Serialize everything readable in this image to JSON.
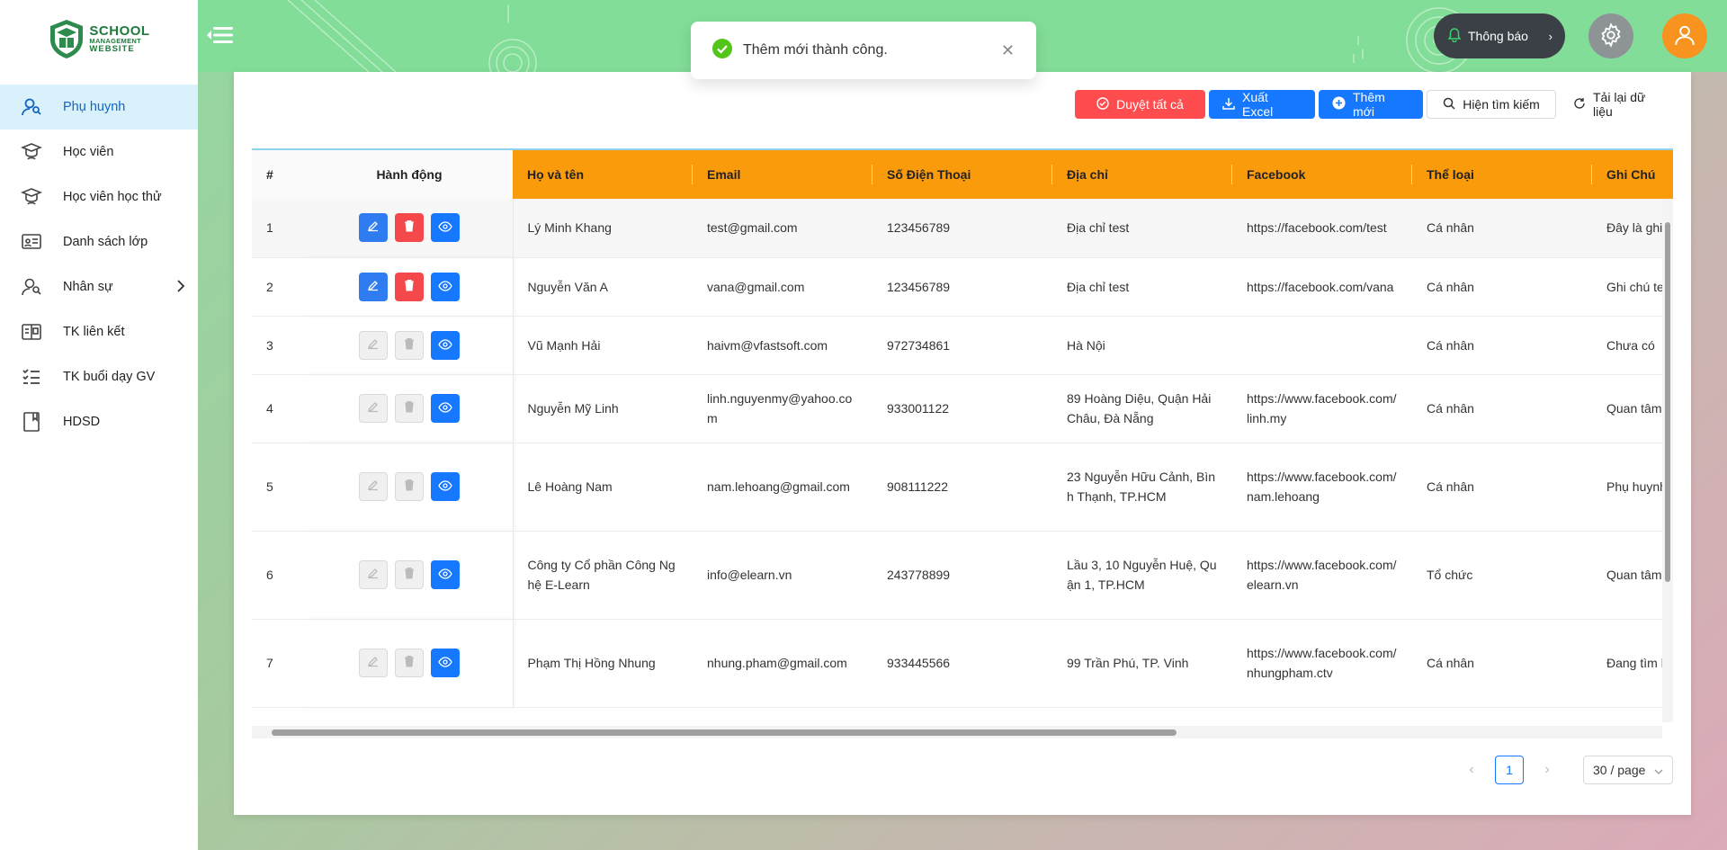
{
  "brand": {
    "line1": "SCHOOL",
    "line2": "MANAGEMENT",
    "line3": "WEBSITE"
  },
  "sidebar": {
    "items": [
      {
        "label": "Phụ huynh",
        "icon": "parent-icon",
        "active": true
      },
      {
        "label": "Học viên",
        "icon": "graduate-icon"
      },
      {
        "label": "Học viên học thử",
        "icon": "trial-student-icon"
      },
      {
        "label": "Danh sách lớp",
        "icon": "classroom-icon"
      },
      {
        "label": "Nhân sự",
        "icon": "staff-icon",
        "has_submenu": true
      },
      {
        "label": "TK liên kết",
        "icon": "linked-account-icon"
      },
      {
        "label": "TK buổi dạy GV",
        "icon": "checklist-icon"
      },
      {
        "label": "HDSD",
        "icon": "book-icon"
      }
    ]
  },
  "header": {
    "notify_label": "Thông báo"
  },
  "toast": {
    "message": "Thêm mới thành công."
  },
  "toolbar": {
    "approve_all": "Duyệt tất cả",
    "export_excel": "Xuất Excel",
    "add_new": "Thêm mới",
    "show_search": "Hiện tìm kiếm",
    "reload": "Tải lại dữ liệu"
  },
  "table": {
    "columns": [
      "#",
      "Hành động",
      "Họ và tên",
      "Email",
      "Số Điện Thoại",
      "Địa chỉ",
      "Facebook",
      "Thể loại",
      "Ghi Chú"
    ],
    "rows": [
      {
        "no": "1",
        "name": "Lý Minh Khang",
        "email": "test@gmail.com",
        "phone": "123456789",
        "address": "Địa chỉ test",
        "facebook": "https://facebook.com/test",
        "type": "Cá nhân",
        "note": "Đây là ghi chú test",
        "editable": true
      },
      {
        "no": "2",
        "name": "Nguyễn Văn A",
        "email": "vana@gmail.com",
        "phone": "123456789",
        "address": "Địa chỉ test",
        "facebook": "https://facebook.com/vana",
        "type": "Cá nhân",
        "note": "Ghi chú test",
        "editable": true
      },
      {
        "no": "3",
        "name": "Vũ Mạnh Hải",
        "email": "haivm@vfastsoft.com",
        "phone": "972734861",
        "address": "Hà Nội",
        "facebook": "",
        "type": "Cá nhân",
        "note": "Chưa có",
        "editable": false
      },
      {
        "no": "4",
        "name": "Nguyễn Mỹ Linh",
        "email": "linh.nguyenmy@yahoo.com",
        "phone": "933001122",
        "address": "89 Hoàng Diệu, Quận Hải Châu, Đà Nẵng",
        "facebook": "https://www.facebook.com/linh.my",
        "type": "Cá nhân",
        "note": "Quan tâm khoá tiếng giao tiếp cho người",
        "editable": false
      },
      {
        "no": "5",
        "name": "Lê Hoàng Nam",
        "email": "nam.lehoang@gmail.com",
        "phone": "908111222",
        "address": "23 Nguyễn Hữu Cảnh, Bình Thạnh, TP.HCM",
        "facebook": "https://www.facebook.com/nam.lehoang",
        "type": "Cá nhân",
        "note": "Phụ huynh học sinh quan tâm luyện thi đ học.",
        "editable": false
      },
      {
        "no": "6",
        "name": "Công ty Cổ phần Công Nghệ E-Learn",
        "email": "info@elearn.vn",
        "phone": "243778899",
        "address": "Lầu 3, 10 Nguyễn Huệ, Quận 1, TP.HCM",
        "facebook": "https://www.facebook.com/elearn.vn",
        "type": "Tổ chức",
        "note": "Quan tâm triển khai tảng học trực tuyến doanh nghiệp.",
        "editable": false
      },
      {
        "no": "7",
        "name": "Phạm Thị Hồng Nhung",
        "email": "nhung.pham@gmail.com",
        "phone": "933445566",
        "address": "99 Trần Phú, TP. Vinh",
        "facebook": "https://www.facebook.com/nhungpham.ctv",
        "type": "Cá nhân",
        "note": "Đang tìm hiểu chươn trình toán tư duy cho tuổi.",
        "editable": false
      }
    ]
  },
  "pagination": {
    "current_page": "1",
    "page_size": "30 / page"
  },
  "colors": {
    "header_bg": "#82dd98",
    "table_header": "#fa9b0c",
    "primary": "#1677ff",
    "danger": "#ff4d4f",
    "accent_user": "#f7931e"
  }
}
